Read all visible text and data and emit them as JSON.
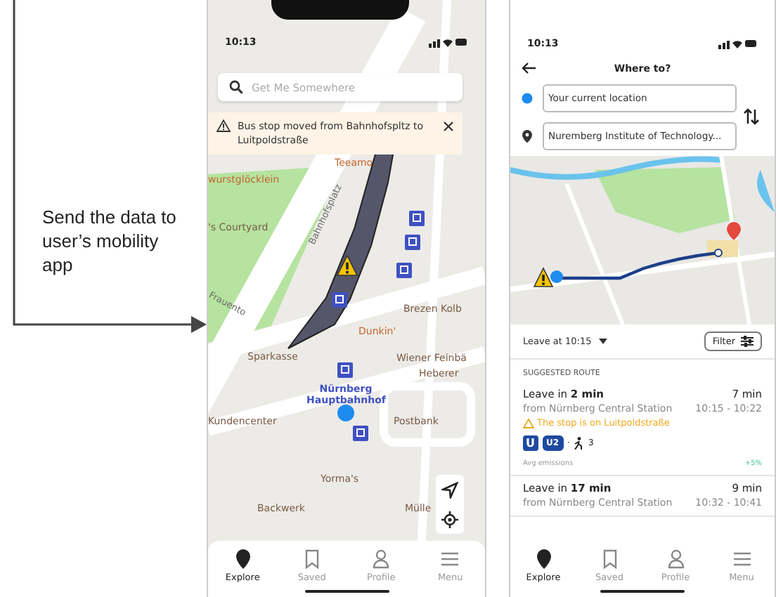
{
  "annotation": {
    "text": "Send the data to user’s mobility app"
  },
  "explore_screen": {
    "status_time": "10:13",
    "search": {
      "placeholder": "Get Me Somewhere"
    },
    "alert": {
      "text": "Bus stop moved from Bahnhofspltz to Luitpoldstraße"
    },
    "map_labels": [
      {
        "text": "wurstglöcklein",
        "kind": "food"
      },
      {
        "text": "'s Courtyard",
        "kind": "poi"
      },
      {
        "text": "Teeamo",
        "kind": "food"
      },
      {
        "text": "Bahnhofsplatz",
        "kind": "street"
      },
      {
        "text": "Frauento",
        "kind": "street"
      },
      {
        "text": "Brezen Kolb",
        "kind": "poi"
      },
      {
        "text": "Dunkin'",
        "kind": "food"
      },
      {
        "text": "Sparkasse",
        "kind": "poi"
      },
      {
        "text": "Wiener Feinbä",
        "kind": "poi"
      },
      {
        "text": "Heberer",
        "kind": "poi"
      },
      {
        "text": "Nürnberg Hauptbahnhof",
        "kind": "station"
      },
      {
        "text": "Kundencenter",
        "kind": "poi"
      },
      {
        "text": "Postbank",
        "kind": "poi"
      },
      {
        "text": "Yorma's",
        "kind": "poi"
      },
      {
        "text": "Backwerk",
        "kind": "poi"
      },
      {
        "text": "Mülle",
        "kind": "poi"
      }
    ],
    "nav": [
      {
        "label": "Explore",
        "selected": true
      },
      {
        "label": "Saved",
        "selected": false
      },
      {
        "label": "Profile",
        "selected": false
      },
      {
        "label": "Menu",
        "selected": false
      }
    ]
  },
  "route_screen": {
    "status_time": "10:13",
    "title": "Where to?",
    "origin": {
      "value": "Your current location"
    },
    "destination": {
      "value": "Nuremberg Institute of Technology..."
    },
    "departure": "Leave at 10:15",
    "filter_button": "Filter",
    "section_title": "SUGGESTED ROUTE",
    "routes": [
      {
        "leave": "Leave in **2 min**",
        "duration": "7 min",
        "from": "from Nürnberg Central Station",
        "times": "10:15 - 10:22",
        "warning": "The stop is on Luitpoldstraße",
        "mode_badge": "U",
        "line": "U2",
        "separator": "·",
        "walk": "3",
        "emissions_label": "Avg emissions",
        "emissions_delta": "+5%"
      },
      {
        "leave": "Leave in **17 min**",
        "duration": "9 min",
        "from": "from Nürnberg Central Station",
        "times": "10:32 - 10:41"
      }
    ],
    "nav": [
      {
        "label": "Explore",
        "selected": true
      },
      {
        "label": "Saved",
        "selected": false
      },
      {
        "label": "Profile",
        "selected": false
      },
      {
        "label": "Menu",
        "selected": false
      }
    ]
  }
}
